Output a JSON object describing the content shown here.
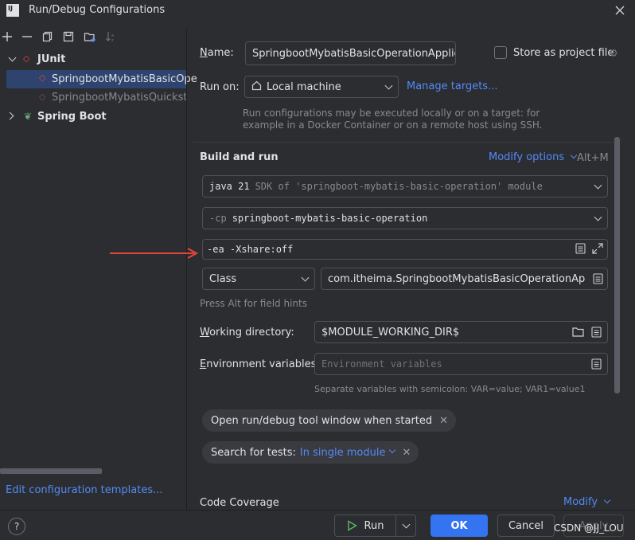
{
  "window": {
    "title": "Run/Debug Configurations",
    "app_icon": "IJ"
  },
  "toolbar": {
    "icons": [
      "add-icon",
      "remove-icon",
      "copy-icon",
      "save-icon",
      "new-folder-icon",
      "sort-icon"
    ]
  },
  "tree": {
    "junit": "JUnit",
    "item1": "SpringbootMybatisBasicOpe",
    "item2": "SpringbootMybatisQuickstar",
    "spring_boot": "Spring Boot"
  },
  "footer_left": {
    "edit_templates": "Edit configuration templates..."
  },
  "form": {
    "name_label_u": "N",
    "name_label_rest": "ame:",
    "name_value": "SpringbootMybatisBasicOperationApplicati",
    "store_label": "Store as project file",
    "run_on_label": "Run on:",
    "run_on_value": "Local machine",
    "manage_targets": "Manage targets...",
    "run_on_hint1": "Run configurations may be executed locally or on a target: for",
    "run_on_hint2": "example in a Docker Container or on a remote host using SSH.",
    "build_run": "Build and run",
    "modify_options": "Modify options",
    "modify_shortcut": "Alt+M",
    "java_version": "java 21",
    "java_sdk": "SDK of 'springboot-mybatis-basic-operation' module",
    "cp_prefix": "-cp",
    "cp_value": "springboot-mybatis-basic-operation",
    "vm_options": "-ea -Xshare:off",
    "class_type": "Class",
    "class_value": "com.itheima.SpringbootMybatisBasicOperationApplicatio",
    "press_alt": "Press Alt for field hints",
    "workdir_label_u": "W",
    "workdir_label_rest": "orking directory:",
    "workdir_value": "$MODULE_WORKING_DIR$",
    "env_label_u": "E",
    "env_label_rest": "nvironment variables:",
    "env_placeholder": "Environment variables",
    "env_hint": "Separate variables with semicolon: VAR=value; VAR1=value1",
    "tag_open_window": "Open run/debug tool window when started",
    "tag_search_prefix": "Search for tests:",
    "tag_search_value": "In single module",
    "code_coverage": "Code Coverage",
    "modify_short": "Modify"
  },
  "buttons": {
    "run": "Run",
    "ok": "OK",
    "cancel": "Cancel",
    "apply": "Apply"
  },
  "watermark": "CSDN @JJ_LOU",
  "colors": {
    "accent": "#3574f0",
    "link": "#548af7",
    "arrow": "#e5463b"
  }
}
